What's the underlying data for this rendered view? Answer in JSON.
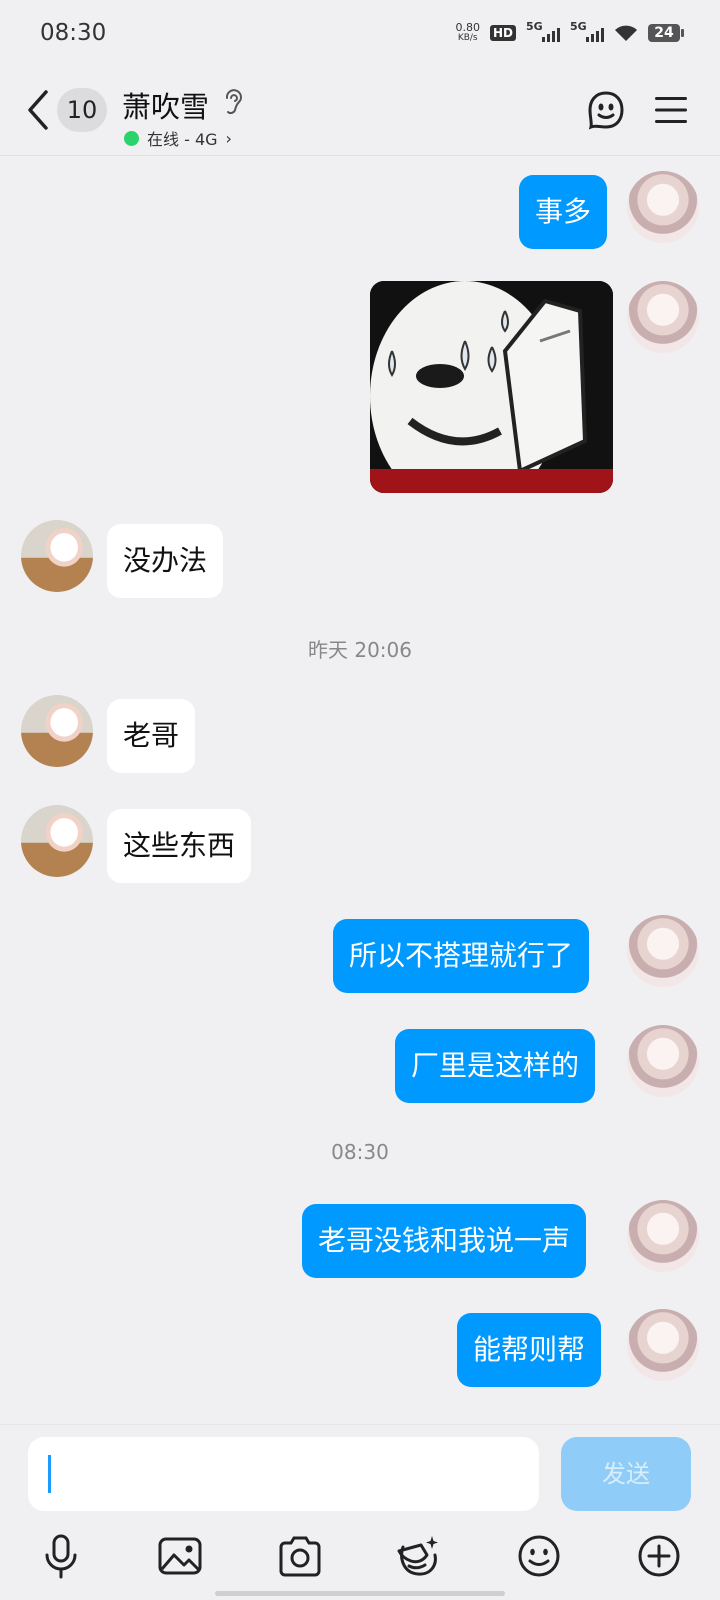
{
  "status_bar": {
    "time": "08:30",
    "net_speed_value": "0.80",
    "net_speed_unit": "KB/s",
    "hd_label": "HD",
    "signal1_label": "5G",
    "signal2_label": "5G",
    "battery": "24"
  },
  "header": {
    "unread_count": "10",
    "contact_name": "萧吹雪",
    "status_text": "在线 - 4G"
  },
  "messages": [
    {
      "side": "out",
      "text": "事多"
    },
    {
      "side": "out",
      "type": "image",
      "icon": "panda-meme-sweating"
    },
    {
      "side": "in",
      "text": "没办法"
    },
    {
      "timestamp": "昨天 20:06"
    },
    {
      "side": "in",
      "text": "老哥"
    },
    {
      "side": "in",
      "text": "这些东西"
    },
    {
      "side": "out",
      "text": "所以不搭理就行了"
    },
    {
      "side": "out",
      "text": "厂里是这样的"
    },
    {
      "timestamp": "08:30"
    },
    {
      "side": "out",
      "text": "老哥没钱和我说一声"
    },
    {
      "side": "out",
      "text": "能帮则帮"
    }
  ],
  "input": {
    "value": "",
    "send_label": "发送"
  },
  "toolbar": [
    "microphone-icon",
    "image-icon",
    "camera-icon",
    "sticker-icon",
    "emoji-icon",
    "plus-icon"
  ],
  "colors": {
    "outgoing_bubble": "#0099ff",
    "incoming_bubble": "#ffffff",
    "background": "#f0f0f2",
    "online_dot": "#2bd46b",
    "send_button_disabled": "#8fcdf8"
  }
}
